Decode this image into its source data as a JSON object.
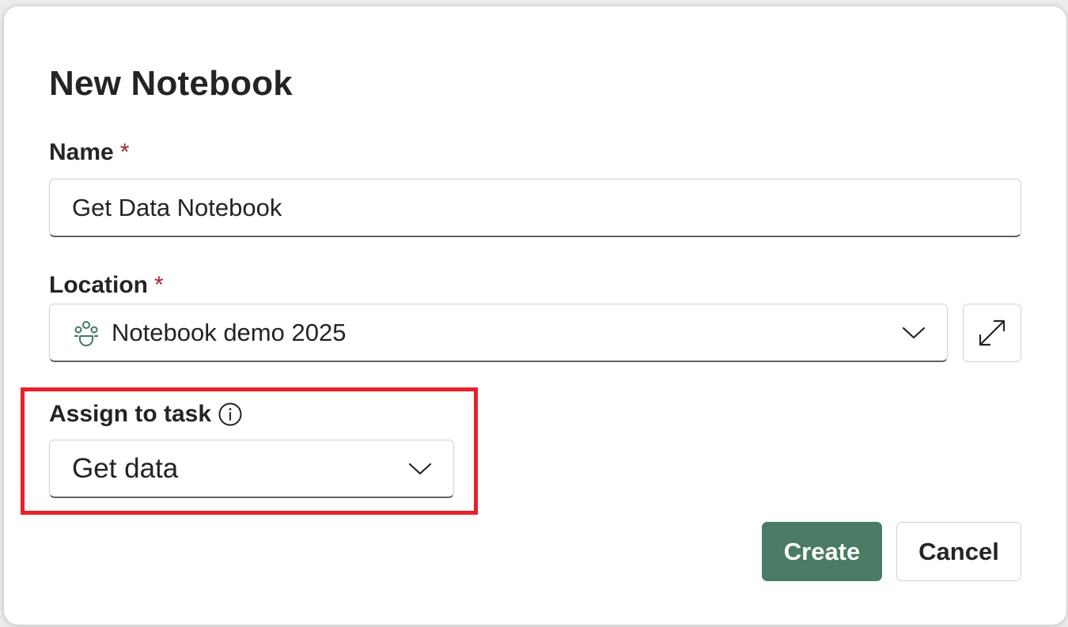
{
  "dialog": {
    "title": "New Notebook"
  },
  "name_field": {
    "label": "Name",
    "required_marker": "*",
    "value": "Get Data Notebook"
  },
  "location_field": {
    "label": "Location",
    "required_marker": "*",
    "value": "Notebook demo 2025",
    "icon": "workspace-icon"
  },
  "task_field": {
    "label": "Assign to task",
    "info_icon": "info-icon",
    "value": "Get data"
  },
  "buttons": {
    "create": "Create",
    "cancel": "Cancel"
  },
  "colors": {
    "primary": "#4a7b64",
    "required": "#a4262c",
    "highlight": "#e8202a"
  }
}
